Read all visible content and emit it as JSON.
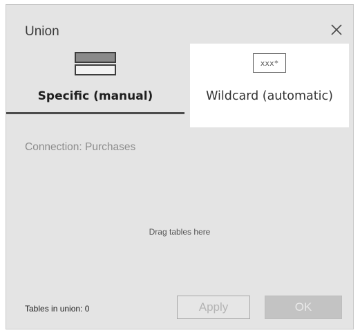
{
  "dialog": {
    "title": "Union"
  },
  "tabs": [
    {
      "label": "Specific (manual)",
      "icon": "table-stack-icon",
      "selected": true
    },
    {
      "label": "Wildcard (automatic)",
      "icon": "wildcard-icon",
      "icon_text": "xxx*",
      "selected": false
    }
  ],
  "connection_label": "Connection: Purchases",
  "drop_hint": "Drag tables here",
  "tables_in_union": "Tables in union: 0",
  "buttons": {
    "apply": "Apply",
    "ok": "OK"
  },
  "colors": {
    "dialog_background": "#e4e4e4",
    "selected_tab_underline": "#4b4b4b",
    "hover_tab_background": "#ffffff",
    "disabled_ok_background": "#c3c3c3"
  }
}
